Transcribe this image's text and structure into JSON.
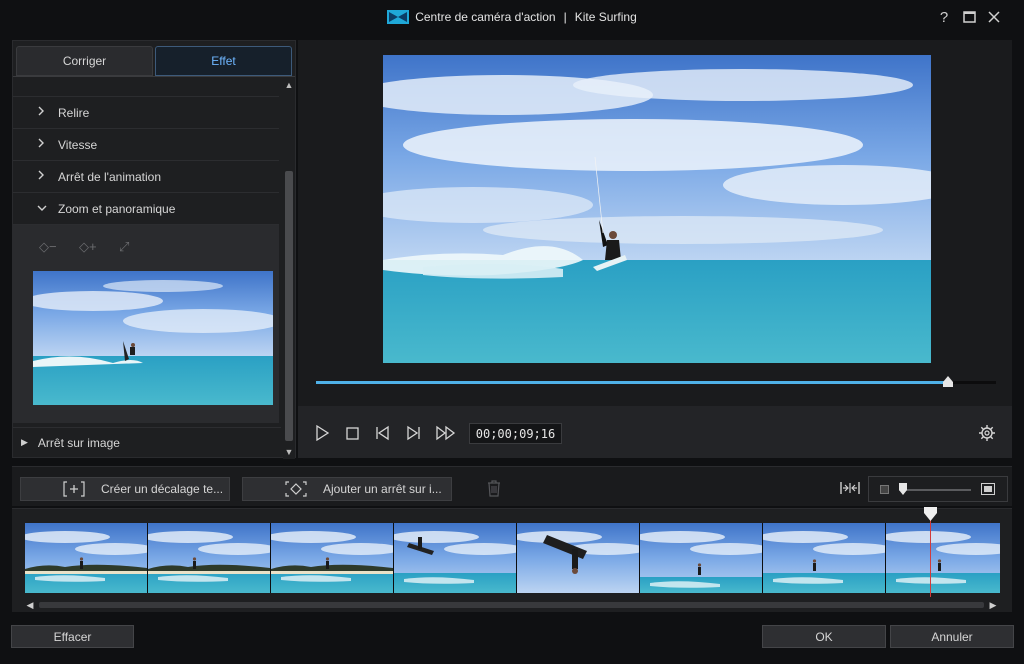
{
  "window": {
    "title": "Centre de caméra d'action",
    "project": "Kite Surfing",
    "separator": "|"
  },
  "titlebar_buttons": [
    {
      "icon": "help-icon",
      "glyph": "?"
    },
    {
      "icon": "maximize-icon"
    },
    {
      "icon": "close-icon"
    }
  ],
  "tabs": [
    {
      "label": "Corriger",
      "active": false
    },
    {
      "label": "Effet",
      "active": true
    }
  ],
  "effect_sections": [
    {
      "label": "Relire",
      "expanded": false
    },
    {
      "label": "Vitesse",
      "expanded": false
    },
    {
      "label": "Arrêt de l'animation",
      "expanded": false
    },
    {
      "label": "Zoom et panoramique",
      "expanded": true
    }
  ],
  "zoom_panel": {
    "tools": [
      "remove-keyframe-icon",
      "add-keyframe-icon",
      "expand-icon"
    ],
    "tool_glyphs": [
      "◇−",
      "◇+",
      "⤢"
    ]
  },
  "freeze_frame": {
    "label": "Arrêt sur image"
  },
  "player": {
    "timecode": "00;00;09;16",
    "progress": 0.93
  },
  "toolbar": {
    "create_offset_label": "Créer un décalage te...",
    "add_freeze_label": "Ajouter un arrêt sur i..."
  },
  "timeline": {
    "playhead_fraction": 0.929,
    "frame_count": 8
  },
  "footer": {
    "clear_label": "Effacer",
    "ok_label": "OK",
    "cancel_label": "Annuler"
  },
  "colors": {
    "accent": "#4fb1e8",
    "tab_active_text": "#6fb6ff",
    "playhead": "#d23a3a"
  }
}
